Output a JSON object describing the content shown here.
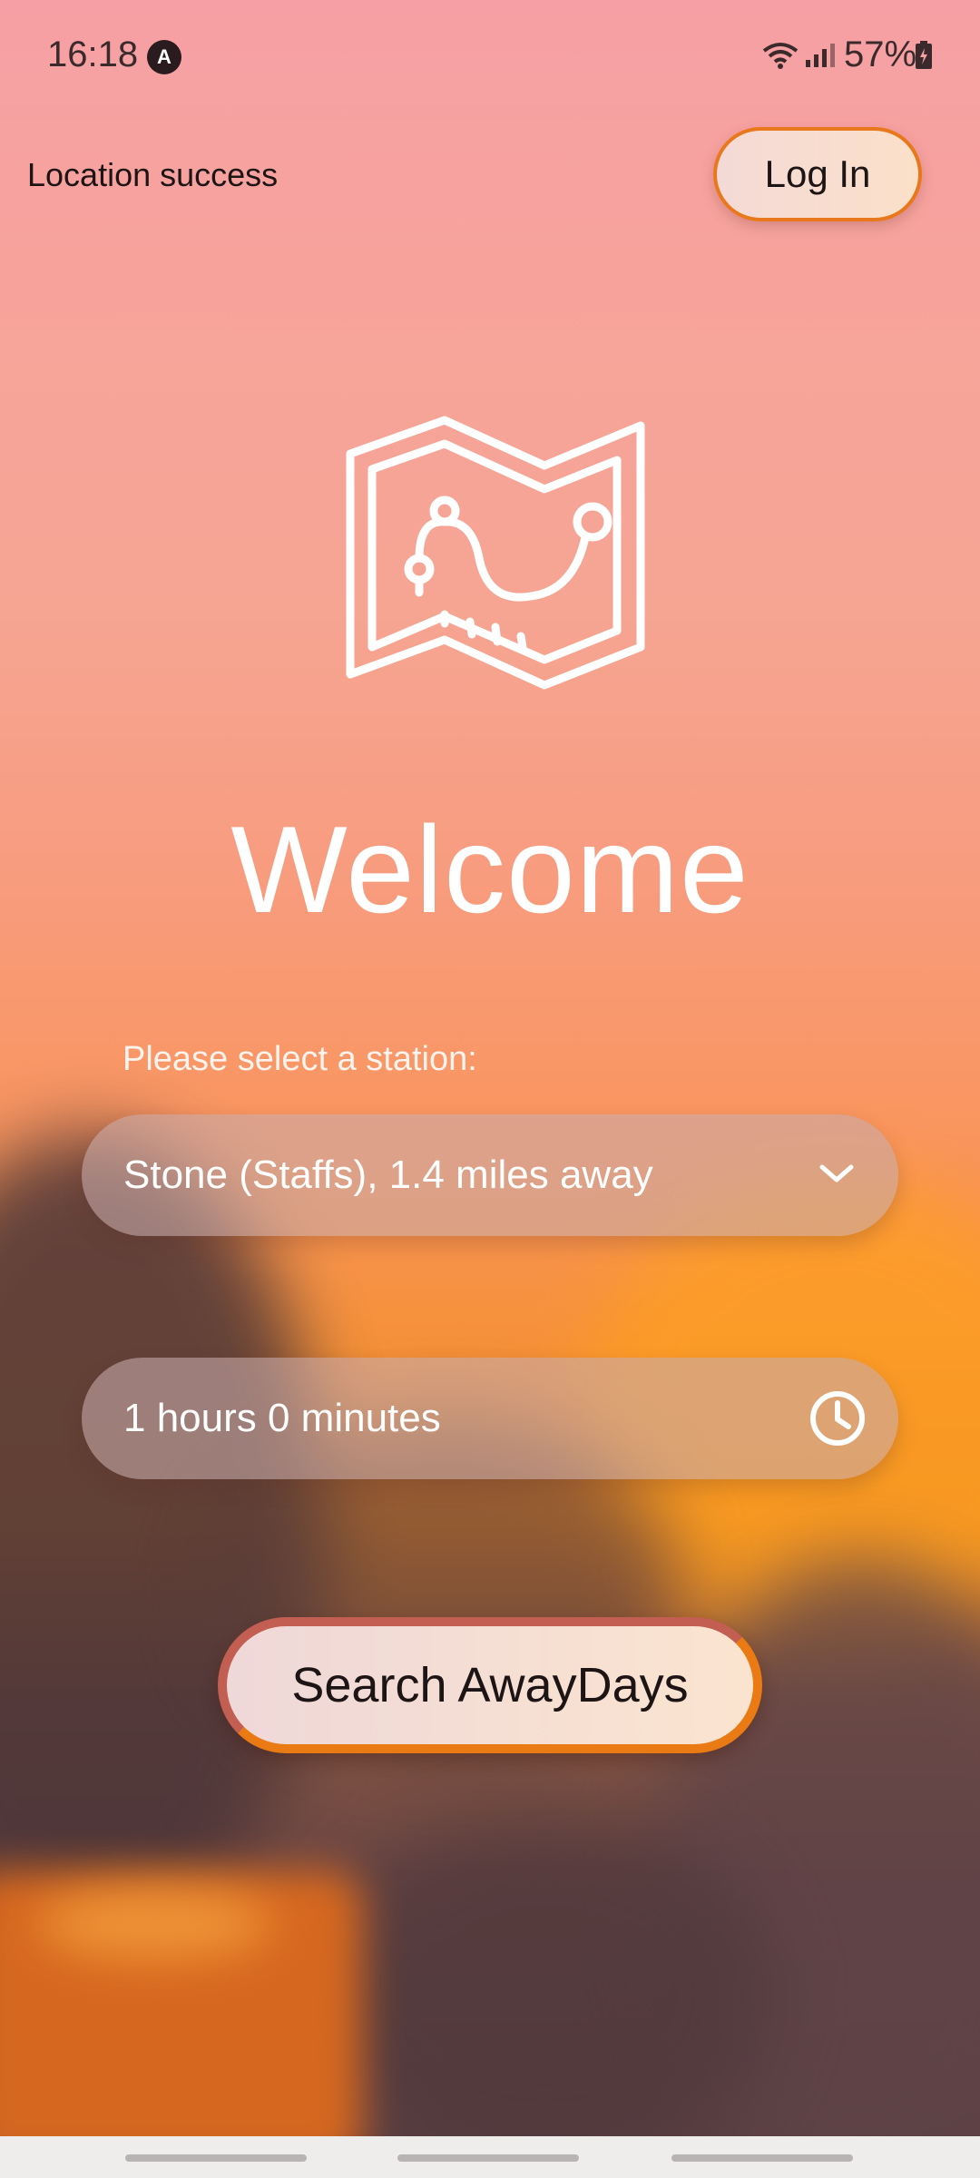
{
  "status_bar": {
    "time": "16:18",
    "app_icon": "A",
    "battery_percent": "57%",
    "icons": [
      "wifi-icon",
      "signal-icon",
      "battery-charging-icon"
    ]
  },
  "header": {
    "location_status": "Location success",
    "login_label": "Log In"
  },
  "main": {
    "illustration_icon": "map-route-icon",
    "title": "Welcome",
    "station_label": "Please select a station:",
    "station_selected": "Stone (Staffs), 1.4 miles away",
    "duration_value": "1 hours 0 minutes",
    "search_label": "Search AwayDays"
  },
  "colors": {
    "accent_orange": "#ea7a14",
    "text_dark": "#1d1415",
    "text_light": "#ffffff"
  }
}
